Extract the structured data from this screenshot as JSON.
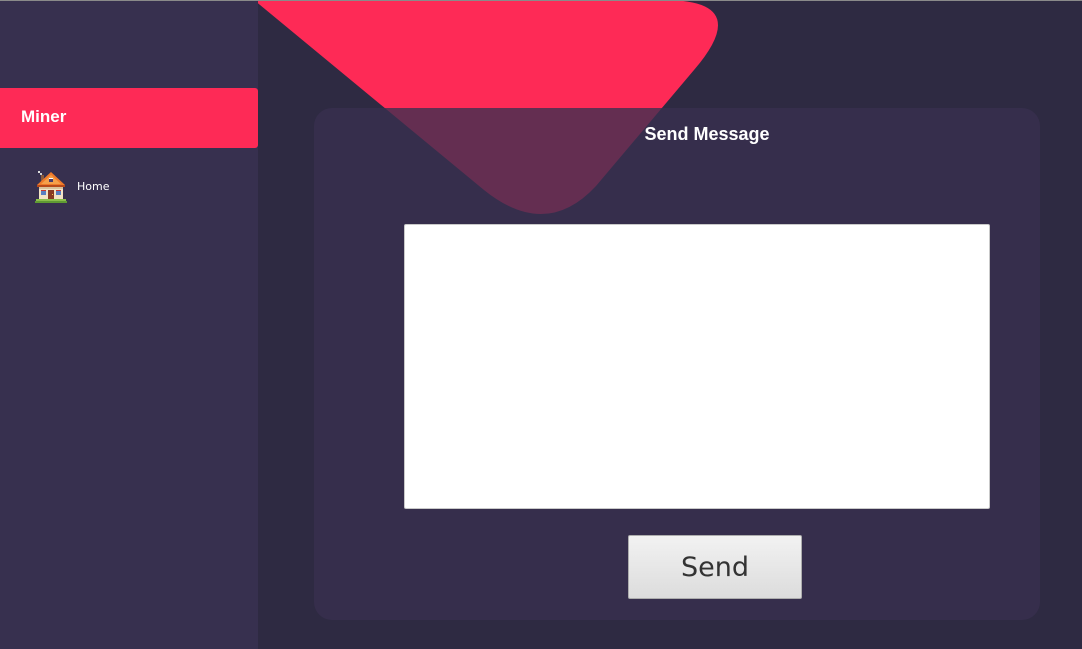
{
  "sidebar": {
    "brand": "Miner",
    "items": [
      {
        "label": "Home",
        "icon": "house-icon"
      }
    ]
  },
  "main": {
    "title": "Send Message",
    "message_input": {
      "value": "",
      "placeholder": ""
    },
    "send_label": "Send"
  },
  "colors": {
    "accent": "#fe2a56",
    "sidebar_bg": "#37304f",
    "main_bg": "#2e2a42",
    "card_bg": "#383050"
  }
}
